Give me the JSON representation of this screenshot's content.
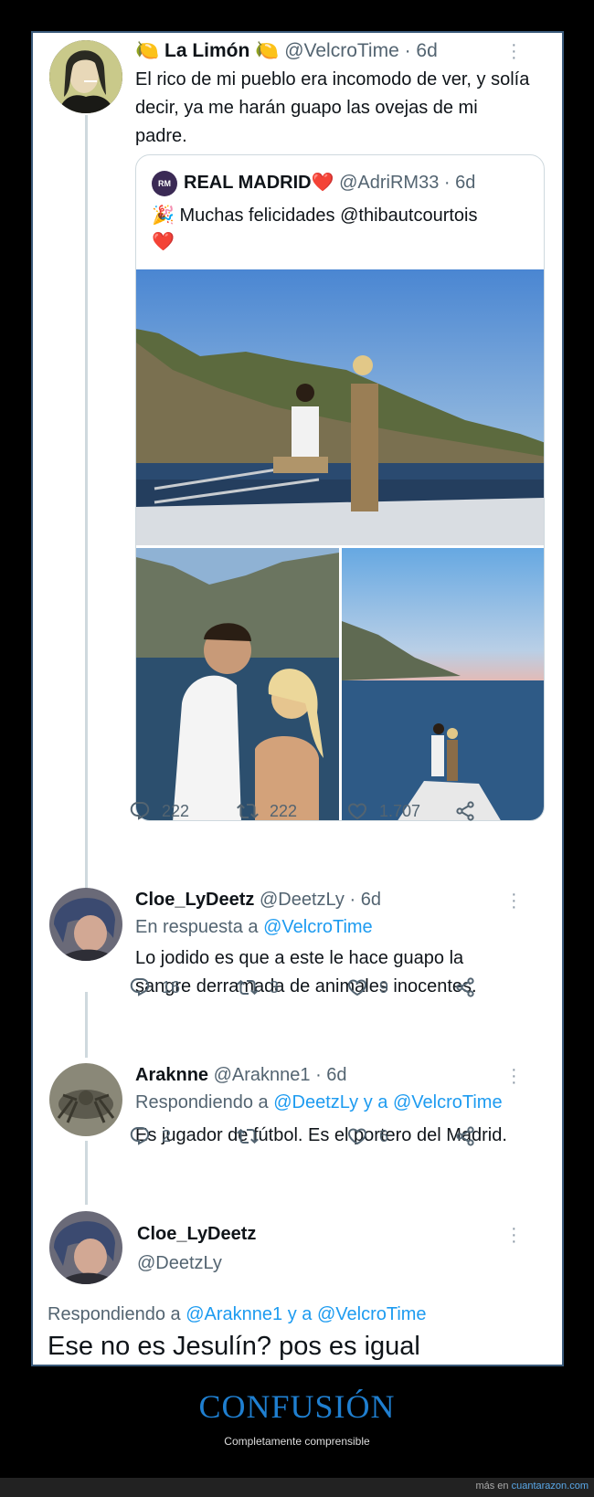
{
  "tweet1": {
    "name": "La Limón",
    "name_emoji": "🍋",
    "handle": "@VelcroTime",
    "time": "· 6d",
    "text": "El rico de mi pueblo era incomodo de ver, y solía decir, ya me harán guapo las ovejas de mi padre.",
    "quote": {
      "name": "REAL MADRID",
      "name_emoji": "❤️",
      "avatar_label": "RM",
      "handle": "@AdriRM33",
      "time": "· 6d",
      "text": "Muchas felicidades @thibautcourtois",
      "emoji_start": "🎉",
      "emoji_end": "❤️"
    },
    "replies": "222",
    "retweets": "222",
    "likes": "1.707"
  },
  "tweet2": {
    "name": "Cloe_LyDeetz",
    "handle": "@DeetzLy",
    "time": "· 6d",
    "reply_prefix": "En respuesta a",
    "reply_to": "@VelcroTime",
    "text": "Lo jodido es que a este le hace guapo la sangre derramada de animales inocentes.",
    "replies": "16",
    "retweets": "3",
    "likes": "9"
  },
  "tweet3": {
    "name": "Araknne",
    "handle": "@Araknne1",
    "time": "· 6d",
    "reply_prefix": "Respondiendo a",
    "reply_to": "@DeetzLy y a @VelcroTime",
    "text": "Es jugador de fútbol. Es el portero del Madrid.",
    "replies": "2",
    "retweets": "",
    "likes": "6"
  },
  "tweet4": {
    "name": "Cloe_LyDeetz",
    "handle": "@DeetzLy",
    "reply_prefix": "Respondiendo a",
    "reply_to": "@Araknne1 y a @VelcroTime",
    "text": "Ese no es Jesulín? pos es igual"
  },
  "footer": {
    "title": "CONFUSIÓN",
    "subtitle": "Completamente comprensible",
    "more_prefix": "más en",
    "site": "cuantarazon.com"
  },
  "colors": {
    "link": "#1d9bf0",
    "secondary_text": "#536471",
    "footer_title": "#1f7fd0"
  }
}
